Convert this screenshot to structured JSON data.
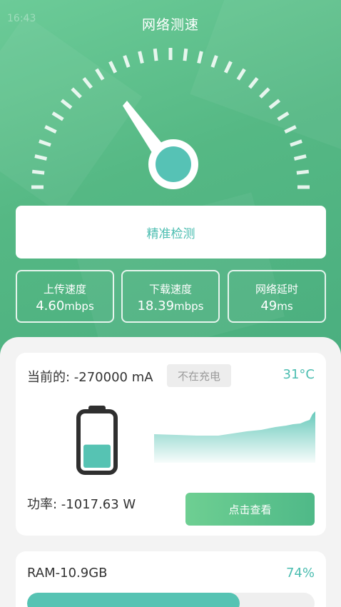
{
  "status_bar": {
    "time": "16:43"
  },
  "header": {
    "title": "网络测速"
  },
  "gauge": {
    "needle_icon": "gauge-needle-icon"
  },
  "actions": {
    "detect_label": "精准检测"
  },
  "stats": [
    {
      "label": "上传速度",
      "value": "4.60",
      "unit": "mbps"
    },
    {
      "label": "下载速度",
      "value": "18.39",
      "unit": "mbps"
    },
    {
      "label": "网络延时",
      "value": "49",
      "unit": "ms"
    }
  ],
  "battery": {
    "current_text": "当前的: -270000 mA",
    "charge_status": "不在充电",
    "temperature": "31°C",
    "level": 0.45,
    "power_text": "功率: -1017.63 W",
    "view_label": "点击查看"
  },
  "ram": {
    "label": "RAM-10.9GB",
    "percent_text": "74%",
    "percent": 74
  },
  "colors": {
    "brand_green": "#55b884",
    "accent_teal": "#4bbdb0"
  }
}
